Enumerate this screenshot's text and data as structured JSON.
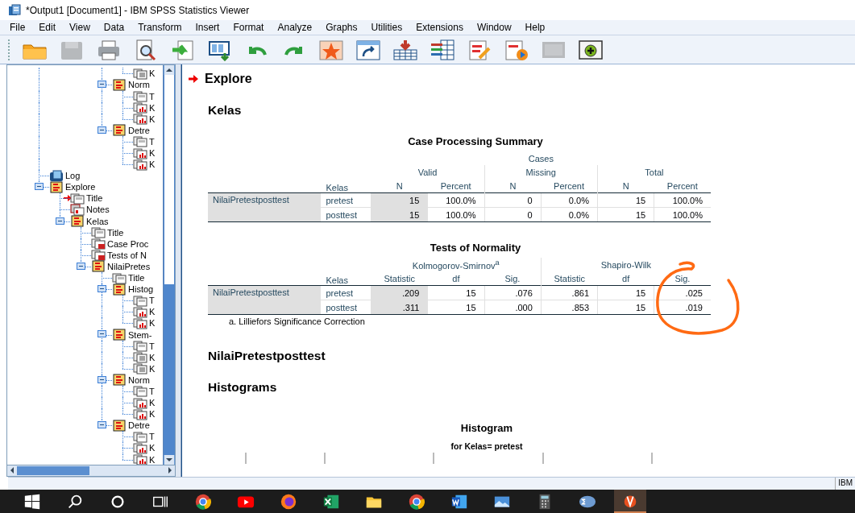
{
  "window": {
    "title": "*Output1 [Document1] - IBM SPSS Statistics Viewer"
  },
  "menu": [
    "File",
    "Edit",
    "View",
    "Data",
    "Transform",
    "Insert",
    "Format",
    "Analyze",
    "Graphs",
    "Utilities",
    "Extensions",
    "Window",
    "Help"
  ],
  "toolbar": [
    {
      "disabled": false
    },
    {
      "disabled": true
    },
    {
      "disabled": false
    },
    {
      "disabled": false
    },
    {
      "disabled": false
    },
    {
      "disabled": false
    },
    {
      "disabled": false
    },
    {
      "disabled": false
    },
    {
      "disabled": false
    },
    {
      "disabled": false
    },
    {
      "disabled": false
    },
    {
      "disabled": false
    },
    {
      "disabled": false
    },
    {
      "disabled": false
    },
    {
      "disabled": true
    },
    {
      "disabled": false
    }
  ],
  "tree": {
    "items": [
      {
        "children": [
          {
            "children": [
              {
                "children": [
                  {
                    "children": [
                      {
                        "label": "K",
                        "kind": "text",
                        "current": false
                      }
                    ]
                  },
                  {
                    "label": "Norm",
                    "kind": "outline",
                    "current": false,
                    "expanded": true,
                    "children": [
                      {
                        "label": "T",
                        "kind": "title",
                        "current": false
                      },
                      {
                        "label": "K",
                        "kind": "chart",
                        "current": false
                      },
                      {
                        "label": "K",
                        "kind": "chart",
                        "current": false
                      }
                    ]
                  },
                  {
                    "label": "Detre",
                    "kind": "outline",
                    "current": false,
                    "expanded": true,
                    "children": [
                      {
                        "label": "T",
                        "kind": "title",
                        "current": false
                      },
                      {
                        "label": "K",
                        "kind": "chart",
                        "current": false
                      },
                      {
                        "label": "K",
                        "kind": "chart",
                        "current": false
                      }
                    ]
                  }
                ]
              }
            ]
          }
        ]
      },
      {
        "label": "Log",
        "kind": "log",
        "current": false
      },
      {
        "label": "Explore",
        "kind": "outline",
        "current": false,
        "expanded": true,
        "children": [
          {
            "label": "Title",
            "kind": "title",
            "current": true
          },
          {
            "label": "Notes",
            "kind": "notes",
            "current": false
          },
          {
            "label": "Kelas",
            "kind": "outline",
            "current": false,
            "expanded": true,
            "children": [
              {
                "label": "Title",
                "kind": "title",
                "current": false
              },
              {
                "label": "Case Proc",
                "kind": "table",
                "current": false
              },
              {
                "label": "Tests of N",
                "kind": "table",
                "current": false
              },
              {
                "label": "NilaiPretes",
                "kind": "outline",
                "current": false,
                "expanded": true,
                "children": [
                  {
                    "label": "Title",
                    "kind": "title",
                    "current": false
                  },
                  {
                    "label": "Histog",
                    "kind": "outline",
                    "current": false,
                    "expanded": true,
                    "children": [
                      {
                        "label": "T",
                        "kind": "title",
                        "current": false
                      },
                      {
                        "label": "K",
                        "kind": "chart",
                        "current": false
                      },
                      {
                        "label": "K",
                        "kind": "chart",
                        "current": false
                      }
                    ]
                  },
                  {
                    "label": "Stem-",
                    "kind": "outline",
                    "current": false,
                    "expanded": true,
                    "children": [
                      {
                        "label": "T",
                        "kind": "title",
                        "current": false
                      },
                      {
                        "label": "K",
                        "kind": "text",
                        "current": false
                      },
                      {
                        "label": "K",
                        "kind": "text",
                        "current": false
                      }
                    ]
                  },
                  {
                    "label": "Norm",
                    "kind": "outline",
                    "current": false,
                    "expanded": true,
                    "children": [
                      {
                        "label": "T",
                        "kind": "title",
                        "current": false
                      },
                      {
                        "label": "K",
                        "kind": "chart",
                        "current": false
                      },
                      {
                        "label": "K",
                        "kind": "chart",
                        "current": false
                      }
                    ]
                  },
                  {
                    "label": "Detre",
                    "kind": "outline",
                    "current": false,
                    "expanded": true,
                    "children": [
                      {
                        "label": "T",
                        "kind": "title",
                        "current": false
                      },
                      {
                        "label": "K",
                        "kind": "chart",
                        "current": false
                      },
                      {
                        "label": "K",
                        "kind": "chart",
                        "current": false
                      }
                    ]
                  }
                ]
              }
            ]
          }
        ]
      }
    ]
  },
  "output": {
    "procedure": "Explore",
    "split_title": "Kelas",
    "case_summary": {
      "title": "Case Processing Summary",
      "spanner": "Cases",
      "groups": [
        "Valid",
        "Missing",
        "Total"
      ],
      "row_header": "Kelas",
      "columns": [
        "N",
        "Percent",
        "N",
        "Percent",
        "N",
        "Percent"
      ],
      "row_group": "NilaiPretestposttest",
      "rows": [
        {
          "label": "pretest",
          "cells": [
            "15",
            "100.0%",
            "0",
            "0.0%",
            "15",
            "100.0%"
          ]
        },
        {
          "label": "posttest",
          "cells": [
            "15",
            "100.0%",
            "0",
            "0.0%",
            "15",
            "100.0%"
          ]
        }
      ]
    },
    "normality": {
      "title": "Tests of Normality",
      "groups": [
        "Kolmogorov-Smirnov$^{a}$",
        "Shapiro-Wilk"
      ],
      "row_header": "Kelas",
      "columns": [
        "Statistic",
        "df",
        "Sig.",
        "Statistic",
        "df",
        "Sig."
      ],
      "row_group": "NilaiPretestposttest",
      "rows": [
        {
          "label": "pretest",
          "cells": [
            ".209",
            "15",
            ".076",
            ".861",
            "15",
            ".025"
          ]
        },
        {
          "label": "posttest",
          "cells": [
            ".311",
            "15",
            ".000",
            ".853",
            "15",
            ".019"
          ]
        }
      ],
      "footnote": "a. Lilliefors Significance Correction"
    },
    "variable_title": "NilaiPretestposttest",
    "section_title": "Histograms",
    "chart": {
      "title": "Histogram",
      "subtitle": "for Kelas= pretest"
    }
  },
  "status_bar": {
    "text": "IBM"
  },
  "taskbar": [
    {
      "kind": "start",
      "selected": false
    },
    {
      "kind": "search",
      "selected": false
    },
    {
      "kind": "cortana",
      "selected": false
    },
    {
      "kind": "taskview",
      "selected": false
    },
    {
      "kind": "chrome",
      "selected": false
    },
    {
      "kind": "youtube",
      "selected": false
    },
    {
      "kind": "firefox",
      "selected": false
    },
    {
      "kind": "excel",
      "selected": false
    },
    {
      "kind": "folder",
      "selected": false
    },
    {
      "kind": "chrome",
      "selected": false
    },
    {
      "kind": "word",
      "selected": false
    },
    {
      "kind": "photos",
      "selected": false
    },
    {
      "kind": "calculator",
      "selected": false
    },
    {
      "kind": "stats",
      "selected": false
    },
    {
      "kind": "app",
      "selected": true
    }
  ]
}
